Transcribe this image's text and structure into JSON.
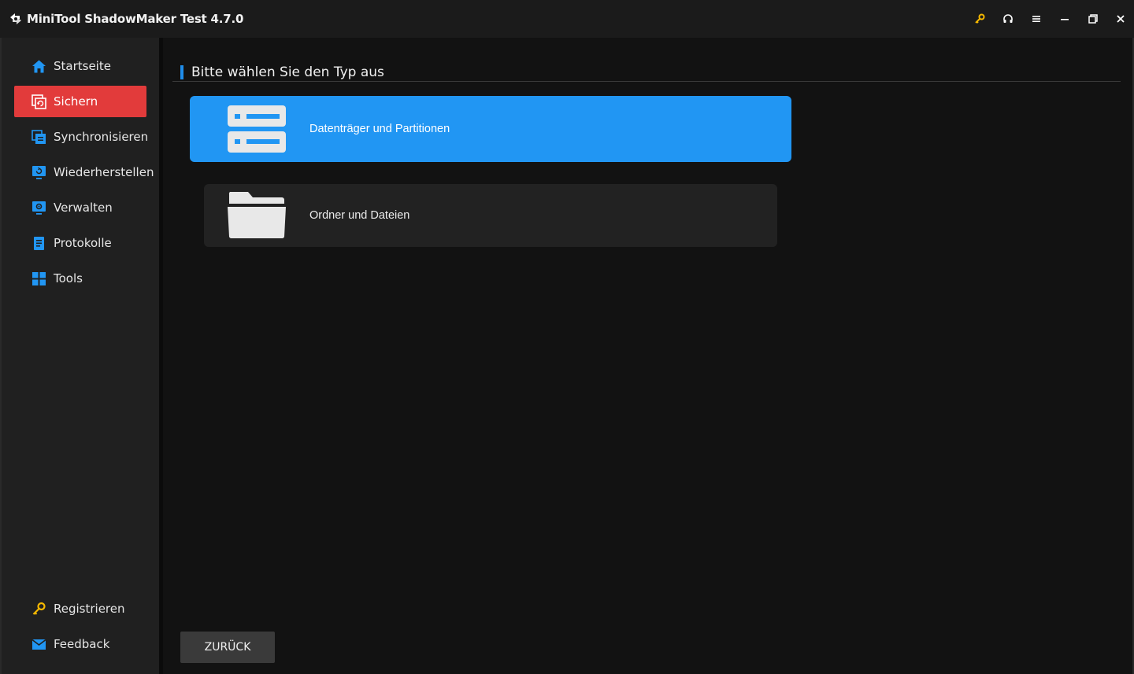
{
  "window": {
    "title": "MiniTool ShadowMaker Test 4.7.0",
    "controls": [
      "key-icon",
      "headset-icon",
      "menu-icon",
      "minimize-icon",
      "restore-icon",
      "close-icon"
    ]
  },
  "sidebar": {
    "items": [
      {
        "label": "Startseite",
        "icon": "home-icon",
        "active": false
      },
      {
        "label": "Sichern",
        "icon": "backup-icon",
        "active": true
      },
      {
        "label": "Synchronisieren",
        "icon": "sync-icon",
        "active": false
      },
      {
        "label": "Wiederherstellen",
        "icon": "restore-monitor-icon",
        "active": false
      },
      {
        "label": "Verwalten",
        "icon": "manage-monitor-icon",
        "active": false
      },
      {
        "label": "Protokolle",
        "icon": "log-document-icon",
        "active": false
      },
      {
        "label": "Tools",
        "icon": "tools-grid-icon",
        "active": false
      }
    ],
    "bottom": [
      {
        "label": "Registrieren",
        "icon": "key-icon"
      },
      {
        "label": "Feedback",
        "icon": "mail-icon"
      }
    ]
  },
  "main": {
    "section_title": "Bitte wählen Sie den Typ aus",
    "options": [
      {
        "label": "Datenträger und Partitionen",
        "icon": "disk-partition-icon",
        "selected": true
      },
      {
        "label": "Ordner und Dateien",
        "icon": "folder-icon",
        "selected": false
      }
    ],
    "back_label": "ZURÜCK"
  },
  "colors": {
    "accent_blue": "#2196f3",
    "active_red": "#e23b3b",
    "key_yellow": "#f5b800"
  }
}
